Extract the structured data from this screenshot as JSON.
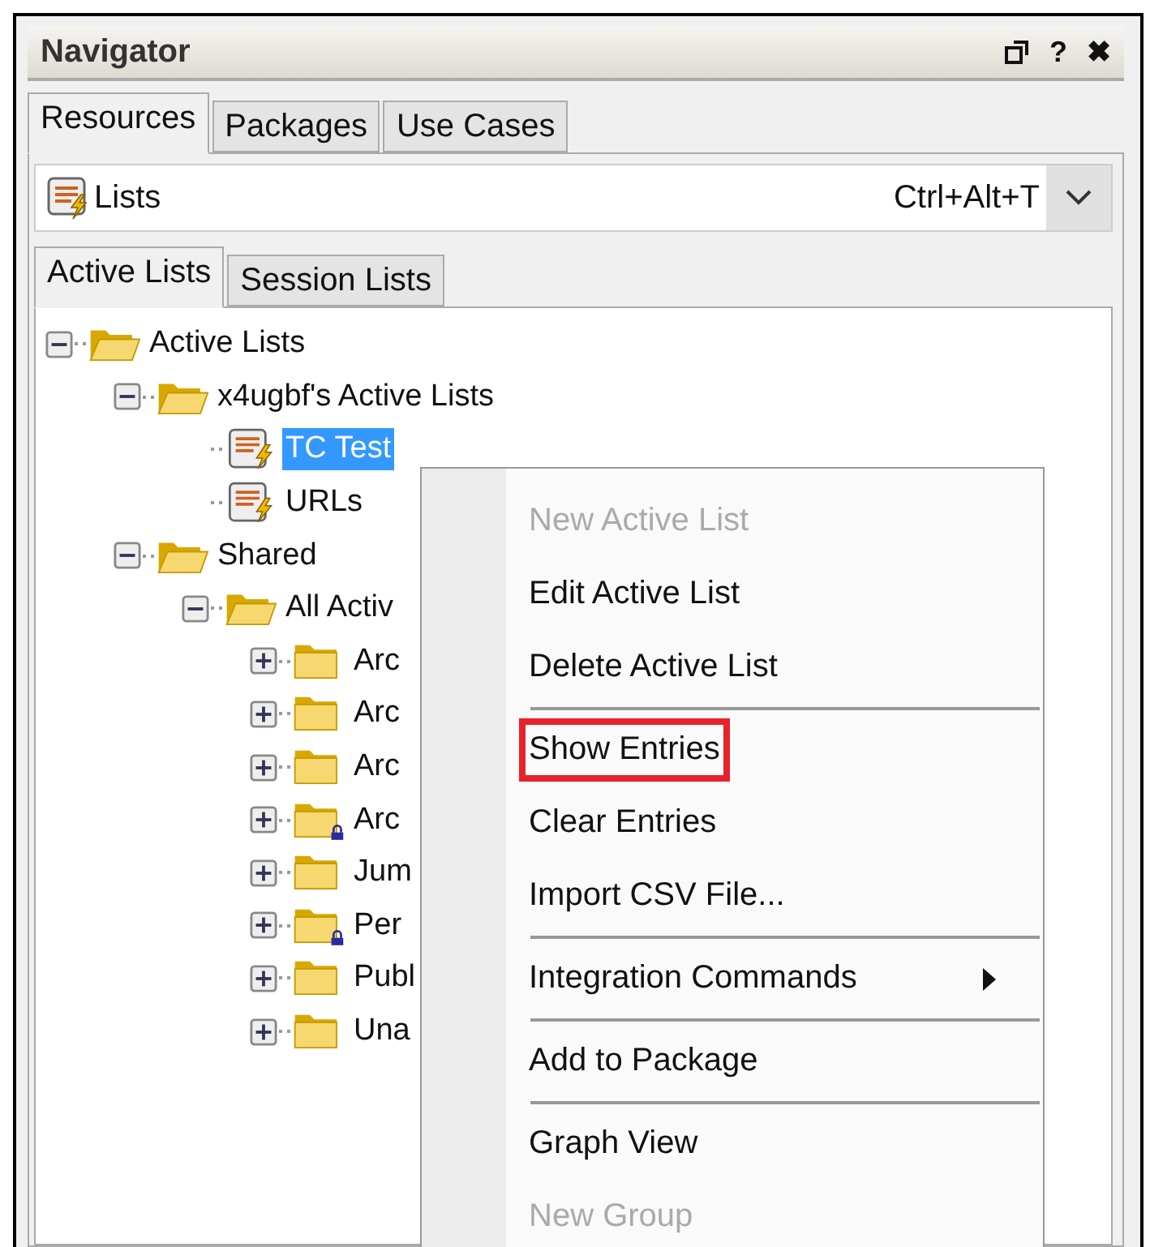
{
  "window": {
    "title": "Navigator",
    "help": "?",
    "close": "✖"
  },
  "tabs": [
    {
      "label": "Resources",
      "selected": true
    },
    {
      "label": "Packages",
      "selected": false
    },
    {
      "label": "Use Cases",
      "selected": false
    }
  ],
  "resource_selector": {
    "value": "Lists",
    "shortcut": "Ctrl+Alt+T"
  },
  "sub_tabs": [
    {
      "label": "Active Lists",
      "selected": true
    },
    {
      "label": "Session Lists",
      "selected": false
    }
  ],
  "tree": [
    {
      "label": "Active Lists",
      "kind": "folder",
      "expanded": true,
      "children": [
        {
          "label": "x4ugbf's Active Lists",
          "kind": "folder",
          "expanded": true,
          "children": [
            {
              "label": "TC Test",
              "kind": "list",
              "selected": true
            },
            {
              "label": "URLs",
              "kind": "list",
              "selected": false
            }
          ]
        },
        {
          "label": "Shared",
          "kind": "folder",
          "expanded": true,
          "children": [
            {
              "label": "All Activ",
              "kind": "folder",
              "expanded": true,
              "children": [
                {
                  "label": "Arc",
                  "kind": "folder",
                  "expanded": false,
                  "locked": false
                },
                {
                  "label": "Arc",
                  "kind": "folder",
                  "expanded": false,
                  "locked": false
                },
                {
                  "label": "Arc",
                  "kind": "folder",
                  "expanded": false,
                  "locked": false
                },
                {
                  "label": "Arc",
                  "kind": "folder",
                  "expanded": false,
                  "locked": true
                },
                {
                  "label": "Jum",
                  "kind": "folder",
                  "expanded": false,
                  "locked": false
                },
                {
                  "label": "Per",
                  "kind": "folder",
                  "expanded": false,
                  "locked": true
                },
                {
                  "label": "Publ",
                  "kind": "folder",
                  "expanded": false,
                  "locked": false
                },
                {
                  "label": "Una",
                  "kind": "folder",
                  "expanded": false,
                  "locked": false
                }
              ]
            }
          ]
        }
      ]
    }
  ],
  "context_menu": [
    {
      "kind": "item",
      "label": "New Active List",
      "disabled": true
    },
    {
      "kind": "item",
      "label": "Edit Active List",
      "disabled": false
    },
    {
      "kind": "item",
      "label": "Delete Active List",
      "disabled": false
    },
    {
      "kind": "separator"
    },
    {
      "kind": "item",
      "label": "Show Entries",
      "disabled": false,
      "highlighted": true
    },
    {
      "kind": "item",
      "label": "Clear Entries",
      "disabled": false
    },
    {
      "kind": "item",
      "label": "Import CSV File...",
      "disabled": false
    },
    {
      "kind": "separator"
    },
    {
      "kind": "item",
      "label": "Integration Commands",
      "disabled": false,
      "submenu": true
    },
    {
      "kind": "separator"
    },
    {
      "kind": "item",
      "label": "Add to Package",
      "disabled": false
    },
    {
      "kind": "separator"
    },
    {
      "kind": "item",
      "label": "Graph View",
      "disabled": false
    },
    {
      "kind": "item",
      "label": "New Group",
      "disabled": true
    }
  ]
}
